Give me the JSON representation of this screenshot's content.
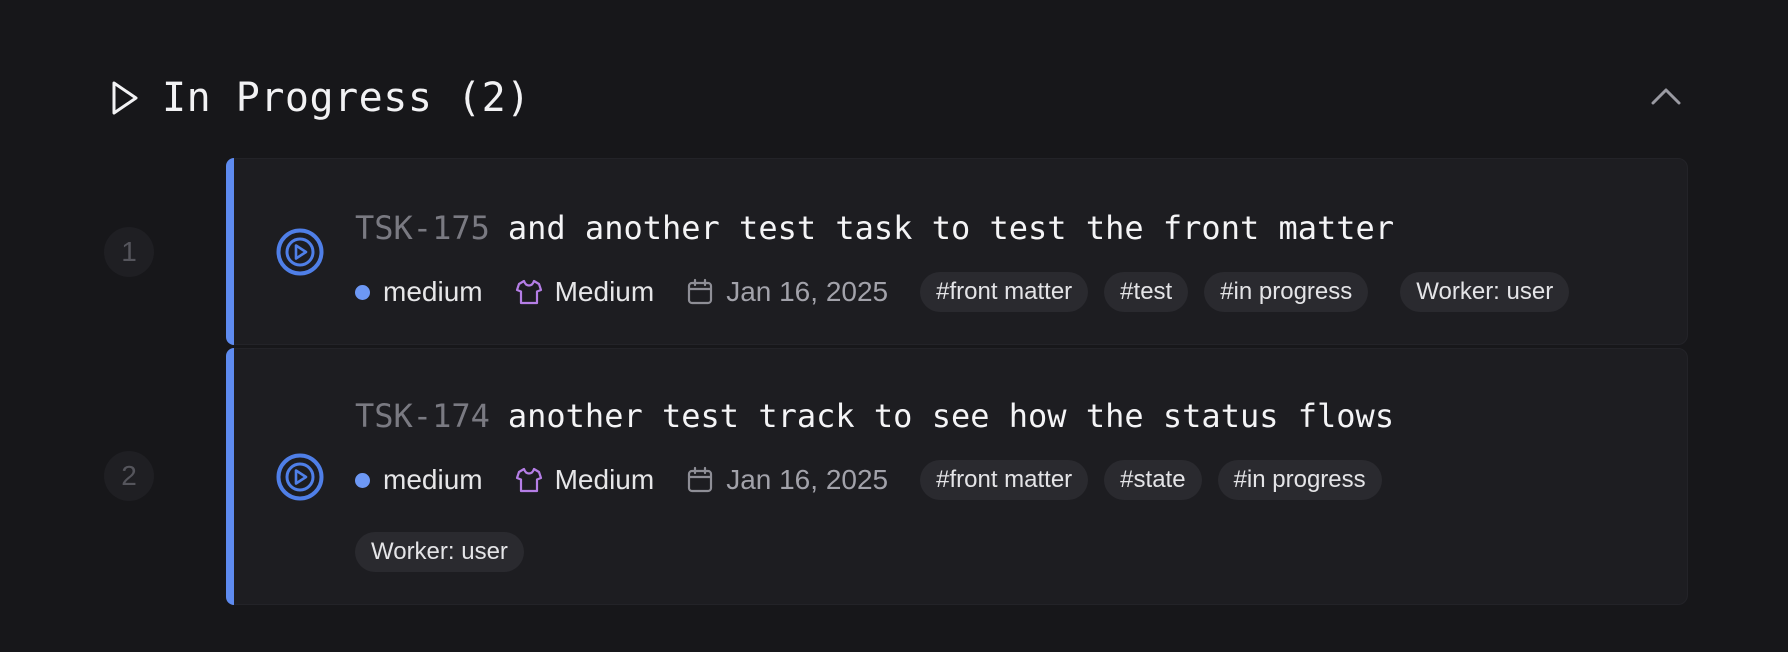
{
  "section": {
    "title": "In Progress (2)",
    "play_icon": "play-outline-icon",
    "collapse_icon": "chevron-up-icon"
  },
  "colors": {
    "accent": "#5e8bf0",
    "priority_dot": "#6d98f5",
    "size_icon": "#b57ee6",
    "background": "#17171a",
    "card": "#1d1d21"
  },
  "tasks": [
    {
      "index": "1",
      "id": "TSK-175",
      "title": "and another test task to test the front matter",
      "priority": "medium",
      "size": "Medium",
      "date": "Jan 16, 2025",
      "tags": [
        "#front matter",
        "#test",
        "#in progress"
      ],
      "worker": "Worker: user",
      "status_icon": "in-progress-circle-play-icon"
    },
    {
      "index": "2",
      "id": "TSK-174",
      "title": "another test track to see how the status flows",
      "priority": "medium",
      "size": "Medium",
      "date": "Jan 16, 2025",
      "tags": [
        "#front matter",
        "#state",
        "#in progress"
      ],
      "worker": "Worker: user",
      "status_icon": "in-progress-circle-play-icon"
    }
  ]
}
